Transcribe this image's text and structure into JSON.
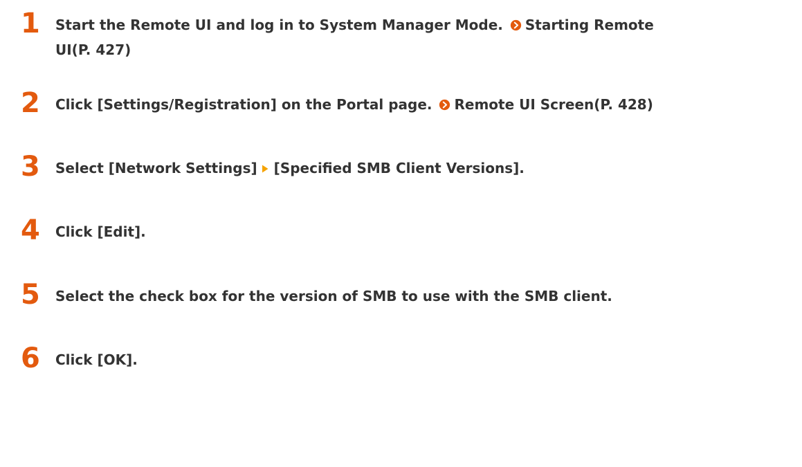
{
  "colors": {
    "step_number": "#e35a0e",
    "text": "#333333",
    "link_icon": "#e35a0e"
  },
  "steps": [
    {
      "number": "1",
      "text": "Start the Remote UI and log in to System Manager Mode. ",
      "link_text_line1": "Starting Remote",
      "link_text_line2": "UI(P. 427)",
      "link_icon": "circle-arrow-right-icon"
    },
    {
      "number": "2",
      "text": "Click [Settings/Registration] on the Portal page. ",
      "link_text": "Remote UI Screen(P. 428)",
      "link_icon": "circle-arrow-right-icon"
    },
    {
      "number": "3",
      "text_before": "Select [Network Settings]",
      "text_after": "[Specified SMB Client Versions].",
      "separator_icon": "triangle-right-icon"
    },
    {
      "number": "4",
      "text": "Click [Edit]."
    },
    {
      "number": "5",
      "text": "Select the check box for the version of SMB to use with the SMB client."
    },
    {
      "number": "6",
      "text": "Click [OK]."
    }
  ]
}
